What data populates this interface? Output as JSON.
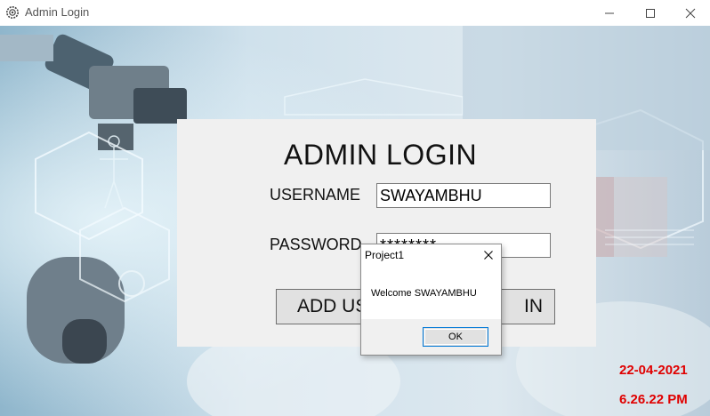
{
  "window": {
    "title": "Admin Login",
    "icon": "gear-icon",
    "controls": {
      "minimize": "minimize-icon",
      "maximize": "maximize-icon",
      "close": "close-icon"
    }
  },
  "login": {
    "heading": "ADMIN LOGIN",
    "username_label": "USERNAME",
    "username_value": "SWAYAMBHU",
    "password_label": "PASSWORD",
    "password_value": "********",
    "add_user_button": "ADD USER",
    "login_button": "LOGIN",
    "add_user_button_visible": "ADD US",
    "login_button_visible": "IN"
  },
  "message_box": {
    "title": "Project1",
    "text": "Welcome SWAYAMBHU",
    "ok_label": "OK"
  },
  "status": {
    "date": "22-04-2021",
    "time": "6.26.22 PM",
    "color": "#e00000"
  }
}
